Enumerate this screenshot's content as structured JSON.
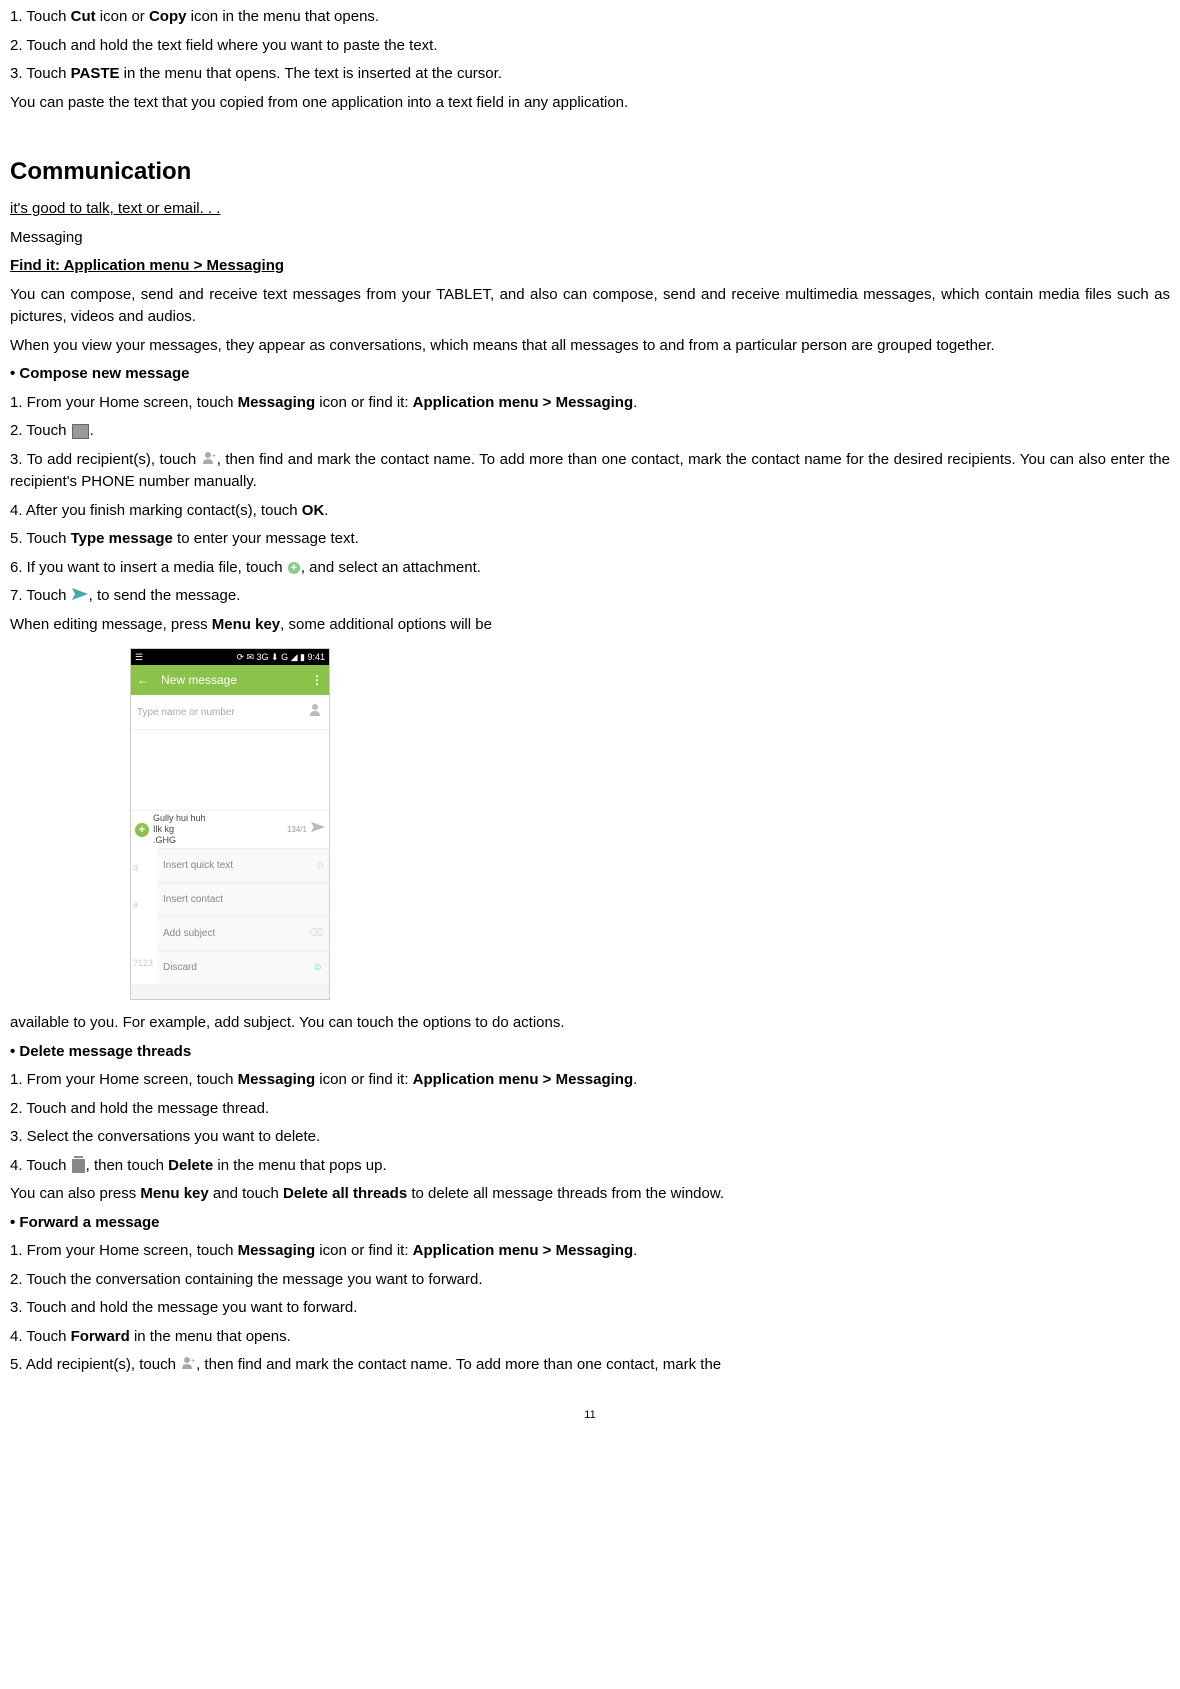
{
  "steps_cut_paste": {
    "s1_pre": "1. Touch ",
    "s1_cut": "Cut",
    "s1_mid": " icon or ",
    "s1_copy": "Copy",
    "s1_post": " icon in the menu that opens.",
    "s2": "2. Touch and hold the text field where you want to paste the text.",
    "s3_pre": "3. Touch ",
    "s3_paste": "PASTE",
    "s3_post": " in the menu that opens. The text is inserted at the cursor.",
    "note": "You can paste the text that you copied from one application into a text field in any application."
  },
  "section_heading": "Communication",
  "tagline": "it's good to talk, text or email. . .",
  "subheading": "Messaging",
  "findit_pre": "Find it: Application menu > Messaging",
  "intro1": "You can compose, send and receive text messages from your TABLET, and also can compose, send and receive multimedia messages, which contain media files such as pictures, videos and audios.",
  "intro2": "When you view your messages, they appear as conversations, which means that all messages to and from a particular person are grouped together.",
  "compose": {
    "head": "• Compose new message",
    "s1_pre": "1. From your Home screen, touch ",
    "s1_msg": "Messaging",
    "s1_mid": " icon or find it: ",
    "s1_find": "Application menu > Messaging",
    "s1_post": ".",
    "s2": "2. Touch ",
    "s2_post": ".",
    "s3_pre": "3. To add recipient(s), touch ",
    "s3_post": ", then find and mark the contact name. To add more than one contact, mark the contact name for the desired recipients. You can also enter the recipient's PHONE number manually.",
    "s4_pre": "4. After you finish marking contact(s), touch ",
    "s4_ok": "OK",
    "s4_post": ".",
    "s5_pre": "5. Touch ",
    "s5_type": "Type message",
    "s5_post": " to enter your message text.",
    "s6_pre": "6. If you want to insert a media file, touch ",
    "s6_post": ", and select an attachment.",
    "s7_pre": "7. Touch ",
    "s7_post": ", to send the message.",
    "note_pre": "When editing message, press ",
    "note_key": "Menu key",
    "note_post": ", some additional options will be",
    "note_after": "available to you. For example, add subject. You can touch the options to do actions."
  },
  "screenshot": {
    "status_left": "☰",
    "status_right": "⟳ ✉ 3G ⬇ G ◢ ▮ 9:41",
    "header_back": "←",
    "header_title": "New message",
    "header_menu": "⋮",
    "input_placeholder": "Type name or number",
    "msg_text1": "Gully hui huh",
    "msg_text2": "Ilk kg",
    "msg_text3": ".GHG",
    "msg_count": "134/1",
    "kb_left": "q",
    "kb_right": "p",
    "kb_row2_left": "a",
    "kb_row3_left": "?123",
    "opt1": "Insert quick text",
    "opt2": "Insert contact",
    "opt3": "Add subject",
    "opt4": "Discard",
    "del_icon": "⌫",
    "emoji_icon": "☺"
  },
  "delete": {
    "head": "• Delete message threads",
    "s1_pre": "1. From your Home screen, touch ",
    "s1_msg": "Messaging",
    "s1_mid": " icon or find it: ",
    "s1_find": "Application menu > Messaging",
    "s1_post": ".",
    "s2": "2. Touch and hold the message thread.",
    "s3": "3. Select the conversations you want to delete.",
    "s4_pre": "4. Touch ",
    "s4_mid": ", then touch ",
    "s4_del": "Delete",
    "s4_post": " in the menu that pops up.",
    "note_pre": "You can also press ",
    "note_key": "Menu key",
    "note_mid": " and touch ",
    "note_del": "Delete all threads",
    "note_post": " to delete all message threads from the window."
  },
  "forward": {
    "head": "• Forward a message",
    "s1_pre": "1. From your Home screen, touch ",
    "s1_msg": "Messaging",
    "s1_mid": " icon or find it: ",
    "s1_find": "Application menu > Messaging",
    "s1_post": ".",
    "s2": "2. Touch the conversation containing the message you want to forward.",
    "s3": "3. Touch and hold the message you want to forward.",
    "s4_pre": "4. Touch ",
    "s4_fwd": "Forward",
    "s4_post": " in the menu that opens.",
    "s5_pre": "5. Add recipient(s), touch ",
    "s5_post": ", then find and mark the contact name. To add more than one contact, mark the"
  },
  "page_number": "11"
}
